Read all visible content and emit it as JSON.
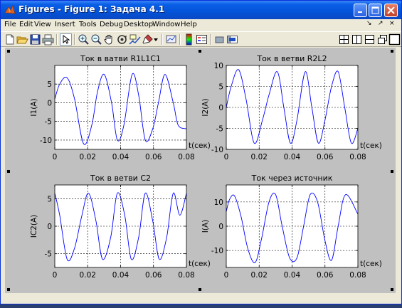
{
  "window": {
    "title": "Figures - Figure 1: Задача 4.1"
  },
  "menu": {
    "items": [
      "File",
      "Edit",
      "View",
      "Insert",
      "Tools",
      "Debug",
      "Desktop",
      "Window",
      "Help"
    ],
    "dock_controls": [
      "↘",
      "↗",
      "×"
    ]
  },
  "toolbar": {
    "icons": [
      "new-figure",
      "open-file",
      "save",
      "print",
      "edit-plot-pointer",
      "zoom-in",
      "zoom-out",
      "pan",
      "rotate-3d",
      "data-cursor",
      "brush",
      "link-plot",
      "insert-colorbar",
      "insert-legend",
      "hide-plot-tools",
      "show-plot-tools"
    ],
    "layout_icons": [
      "tile-grid",
      "tile-columns",
      "tile-rows",
      "float",
      "maximize"
    ]
  },
  "colors": {
    "titlebar": "#0453d9",
    "figure_background": "#c0c0c0",
    "axes_background": "#ffffff",
    "line": "#0000ff"
  },
  "chart_data": [
    {
      "type": "line",
      "title": "Ток в ватви R1L1C1",
      "xlabel": "t(сек)",
      "ylabel": "I1(A)",
      "xlim": [
        0,
        0.08
      ],
      "ylim": [
        -12.5,
        10
      ],
      "xticks": [
        0,
        0.02,
        0.04,
        0.06,
        0.08
      ],
      "xtick_labels": [
        "0",
        "0.02",
        "0.04",
        "0.06",
        "0.08"
      ],
      "yticks": [
        -10,
        -5,
        0,
        5
      ],
      "ytick_labels": [
        "-10",
        "-5",
        "0",
        "5"
      ],
      "grid": true,
      "series": [
        {
          "x": [
            0,
            0.003,
            0.0075,
            0.012,
            0.0175,
            0.0225,
            0.026,
            0.03,
            0.0345,
            0.038,
            0.042,
            0.047,
            0.051,
            0.055,
            0.0595,
            0.063,
            0.067,
            0.072,
            0.075,
            0.08
          ],
          "values": [
            1,
            5,
            6.7,
            1,
            -11,
            -6,
            3,
            7.6,
            0,
            -10,
            -6,
            7.6,
            2,
            -10,
            -7,
            0,
            7.6,
            0,
            -6,
            -7
          ]
        }
      ]
    },
    {
      "type": "line",
      "title": "Ток в ветви R2L2",
      "xlabel": "t(сек)",
      "ylabel": "I2(A)",
      "xlim": [
        0,
        0.08
      ],
      "ylim": [
        -10,
        10
      ],
      "xticks": [
        0,
        0.02,
        0.04,
        0.06,
        0.08
      ],
      "xtick_labels": [
        "0",
        "0.02",
        "0.04",
        "0.06",
        "0.08"
      ],
      "yticks": [
        -10,
        -5,
        0,
        5,
        10
      ],
      "ytick_labels": [
        "-10",
        "-5",
        "0",
        "5",
        "10"
      ],
      "grid": true,
      "series": [
        {
          "x": [
            0,
            0.003,
            0.0075,
            0.012,
            0.017,
            0.022,
            0.026,
            0.031,
            0.035,
            0.039,
            0.043,
            0.048,
            0.052,
            0.056,
            0.06,
            0.064,
            0.068,
            0.072,
            0.076,
            0.08
          ],
          "values": [
            0,
            5,
            9,
            2,
            -8.5,
            -3,
            3,
            8.5,
            0,
            -8.5,
            -3,
            8.5,
            0,
            -8.5,
            -3,
            5,
            8.5,
            0,
            -8.5,
            -5
          ]
        }
      ]
    },
    {
      "type": "line",
      "title": "Ток в ветви C2",
      "xlabel": "t(сек)",
      "ylabel": "IC2(A)",
      "xlim": [
        0,
        0.08
      ],
      "ylim": [
        -7.5,
        7.5
      ],
      "xticks": [
        0,
        0.02,
        0.04,
        0.06,
        0.08
      ],
      "xtick_labels": [
        "0",
        "0.02",
        "0.04",
        "0.06",
        "0.08"
      ],
      "yticks": [
        -5,
        0,
        5
      ],
      "ytick_labels": [
        "-5",
        "0",
        "5"
      ],
      "grid": true,
      "series": [
        {
          "x": [
            0,
            0.003,
            0.0075,
            0.012,
            0.0165,
            0.0205,
            0.025,
            0.029,
            0.034,
            0.038,
            0.0425,
            0.0465,
            0.051,
            0.055,
            0.0595,
            0.0635,
            0.068,
            0.072,
            0.076,
            0.08
          ],
          "values": [
            6,
            2,
            -6,
            -4,
            2,
            6,
            1,
            -6,
            -2,
            6,
            2,
            -6,
            -2,
            6,
            1,
            -6,
            -2,
            6,
            2,
            6
          ]
        }
      ]
    },
    {
      "type": "line",
      "title": "Ток через источник",
      "xlabel": "t(сек)",
      "ylabel": "I(A)",
      "xlim": [
        0,
        0.08
      ],
      "ylim": [
        -17,
        17
      ],
      "xticks": [
        0,
        0.02,
        0.04,
        0.06,
        0.08
      ],
      "xtick_labels": [
        "0",
        "0.02",
        "0.04",
        "0.06",
        "0.08"
      ],
      "yticks": [
        -10,
        0,
        10
      ],
      "ytick_labels": [
        "-10",
        "0",
        "10"
      ],
      "grid": true,
      "series": [
        {
          "x": [
            0,
            0.002,
            0.005,
            0.009,
            0.013,
            0.0175,
            0.0215,
            0.026,
            0.03,
            0.034,
            0.0385,
            0.043,
            0.047,
            0.051,
            0.0555,
            0.06,
            0.064,
            0.068,
            0.0725,
            0.08
          ],
          "values": [
            6,
            11,
            12.5,
            4,
            -9,
            -15,
            -5,
            10,
            13,
            0,
            -13,
            -13,
            0,
            13,
            10,
            -6,
            -14,
            0,
            13,
            5
          ]
        }
      ]
    }
  ]
}
